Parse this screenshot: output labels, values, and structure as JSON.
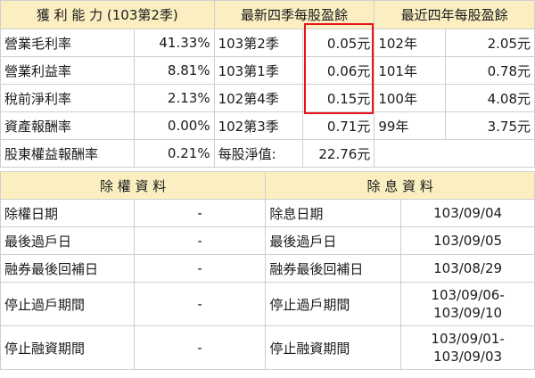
{
  "earnings": {
    "profit_header": "獲 利 能 力 (103第2季)",
    "eps4q_header": "最新四季每股盈餘",
    "eps4y_header": "最近四年每股盈餘",
    "rows": [
      {
        "metric": "營業毛利率",
        "metric_value": "41.33%",
        "quarter": "103第2季",
        "quarter_eps": "0.05元",
        "year": "102年",
        "year_eps": "2.05元"
      },
      {
        "metric": "營業利益率",
        "metric_value": "8.81%",
        "quarter": "103第1季",
        "quarter_eps": "0.06元",
        "year": "101年",
        "year_eps": "0.78元"
      },
      {
        "metric": "稅前淨利率",
        "metric_value": "2.13%",
        "quarter": "102第4季",
        "quarter_eps": "0.15元",
        "year": "100年",
        "year_eps": "4.08元"
      },
      {
        "metric": "資產報酬率",
        "metric_value": "0.00%",
        "quarter": "102第3季",
        "quarter_eps": "0.71元",
        "year": "99年",
        "year_eps": "3.75元"
      }
    ],
    "roe_label": "股東權益報酬率",
    "roe_value": "0.21%",
    "bvps_label": "每股淨值:",
    "bvps_value": "22.76元"
  },
  "rights": {
    "ex_rights_header": "除 權 資 料",
    "ex_dividend_header": "除 息 資 料",
    "rows": [
      {
        "left_label": "除權日期",
        "left_value": "-",
        "right_label": "除息日期",
        "right_value": "103/09/04"
      },
      {
        "left_label": "最後過戶日",
        "left_value": "-",
        "right_label": "最後過戶日",
        "right_value": "103/09/05"
      },
      {
        "left_label": "融券最後回補日",
        "left_value": "-",
        "right_label": "融券最後回補日",
        "right_value": "103/08/29"
      },
      {
        "left_label": "停止過戶期間",
        "left_value": "-",
        "right_label": "停止過戶期間",
        "right_value": "103/09/06-103/09/10"
      },
      {
        "left_label": "停止融資期間",
        "left_value": "-",
        "right_label": "停止融資期間",
        "right_value": "103/09/01-103/09/03"
      }
    ]
  },
  "colors": {
    "header_bg": "#fbefc2",
    "highlight": "#e8141a",
    "border": "#cfcfcf"
  }
}
